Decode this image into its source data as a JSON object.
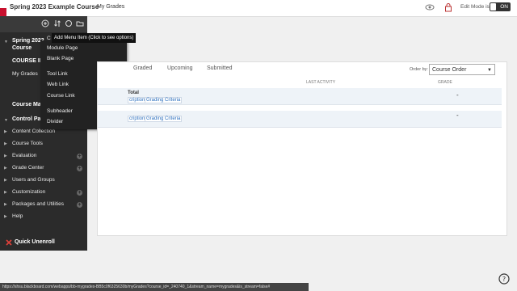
{
  "topbar": {
    "course_title": "Spring 2023 Example Course",
    "crumb": "My Grades",
    "edit_mode_label": "Edit Mode is:",
    "edit_mode_state": "ON"
  },
  "sidebar": {
    "course_short": "Spring 2023",
    "course_short2": "Course",
    "course_info": "COURSE IN",
    "my_grades": "My Grades",
    "course_management": "Course Ma",
    "control_panel": "Control Pa",
    "items": [
      {
        "label": "Content Collection",
        "plus": false
      },
      {
        "label": "Course Tools",
        "plus": false
      },
      {
        "label": "Evaluation",
        "plus": true
      },
      {
        "label": "Grade Center",
        "plus": true
      },
      {
        "label": "Users and Groups",
        "plus": false
      },
      {
        "label": "Customization",
        "plus": true
      },
      {
        "label": "Packages and Utilities",
        "plus": true
      },
      {
        "label": "Help",
        "plus": false
      }
    ],
    "quick_unenroll": "Quick Unenroll"
  },
  "tooltip": "Add Menu Item (Click to see options)",
  "menu": {
    "partial_top": "C",
    "items": [
      "Module Page",
      "Blank Page",
      "Tool Link",
      "Web Link",
      "Course Link",
      "Subheader",
      "Divider"
    ]
  },
  "main": {
    "tabs": [
      "Graded",
      "Upcoming",
      "Submitted"
    ],
    "order_label": "Order by:",
    "order_value": "Course Order",
    "columns": {
      "last_activity": "LAST ACTIVITY",
      "grade": "GRADE"
    },
    "rows": [
      {
        "title": "Total",
        "links": [
          "cription",
          "Grading Criteria"
        ],
        "grade": "-"
      },
      {
        "title": "",
        "links": [
          "cription",
          "Grading Criteria"
        ],
        "grade": "-"
      }
    ]
  },
  "statusbar": "https://shsu.blackboard.com/webapps/bb-mygrades-BB5c0f6325630b/myGrades?course_id=_240740_1&stream_name=mygrades&is_stream=false#",
  "colors": {
    "accent": "#c8102e",
    "sidebar": "#2b2b2b",
    "link": "#2a6ebd"
  }
}
